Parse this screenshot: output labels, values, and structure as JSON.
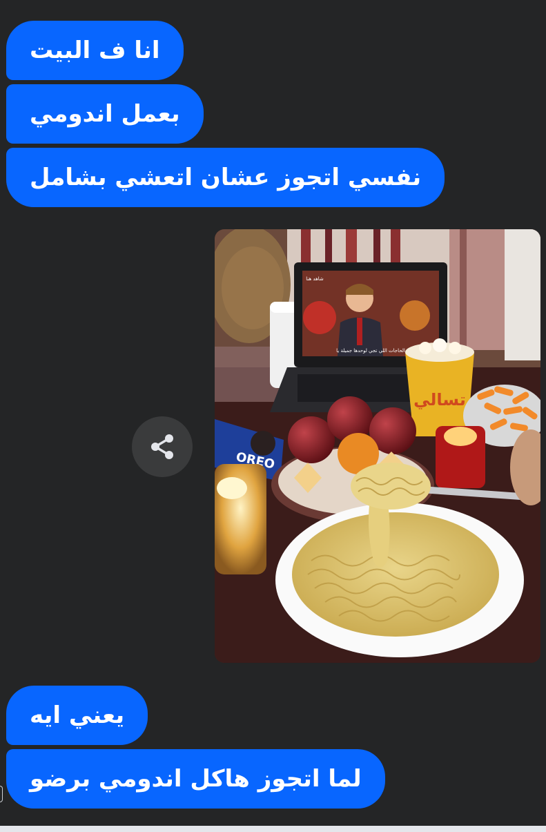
{
  "colors": {
    "background": "#242526",
    "bubble": "#0866ff",
    "bubble_text": "#ffffff",
    "share_button_bg": "#3a3b3c"
  },
  "messages_before_photo": [
    {
      "text": "انا ف البيت"
    },
    {
      "text": "بعمل اندومي"
    },
    {
      "text": "نفسي اتجوز عشان اتعشي بشامل"
    }
  ],
  "shared_photo": {
    "laptop_subtitle": "الحاجات اللي تجي لوحدها جميلة يا",
    "laptop_channel": "شاهد هنا",
    "popcorn_cup_text": "تسالي",
    "cookie_pack_text": "OREO"
  },
  "share_icon": "share-icon",
  "messages_after_photo": [
    {
      "text": "يعني ايه"
    },
    {
      "text": "لما اتجوز هاكل اندومي برضو"
    }
  ]
}
